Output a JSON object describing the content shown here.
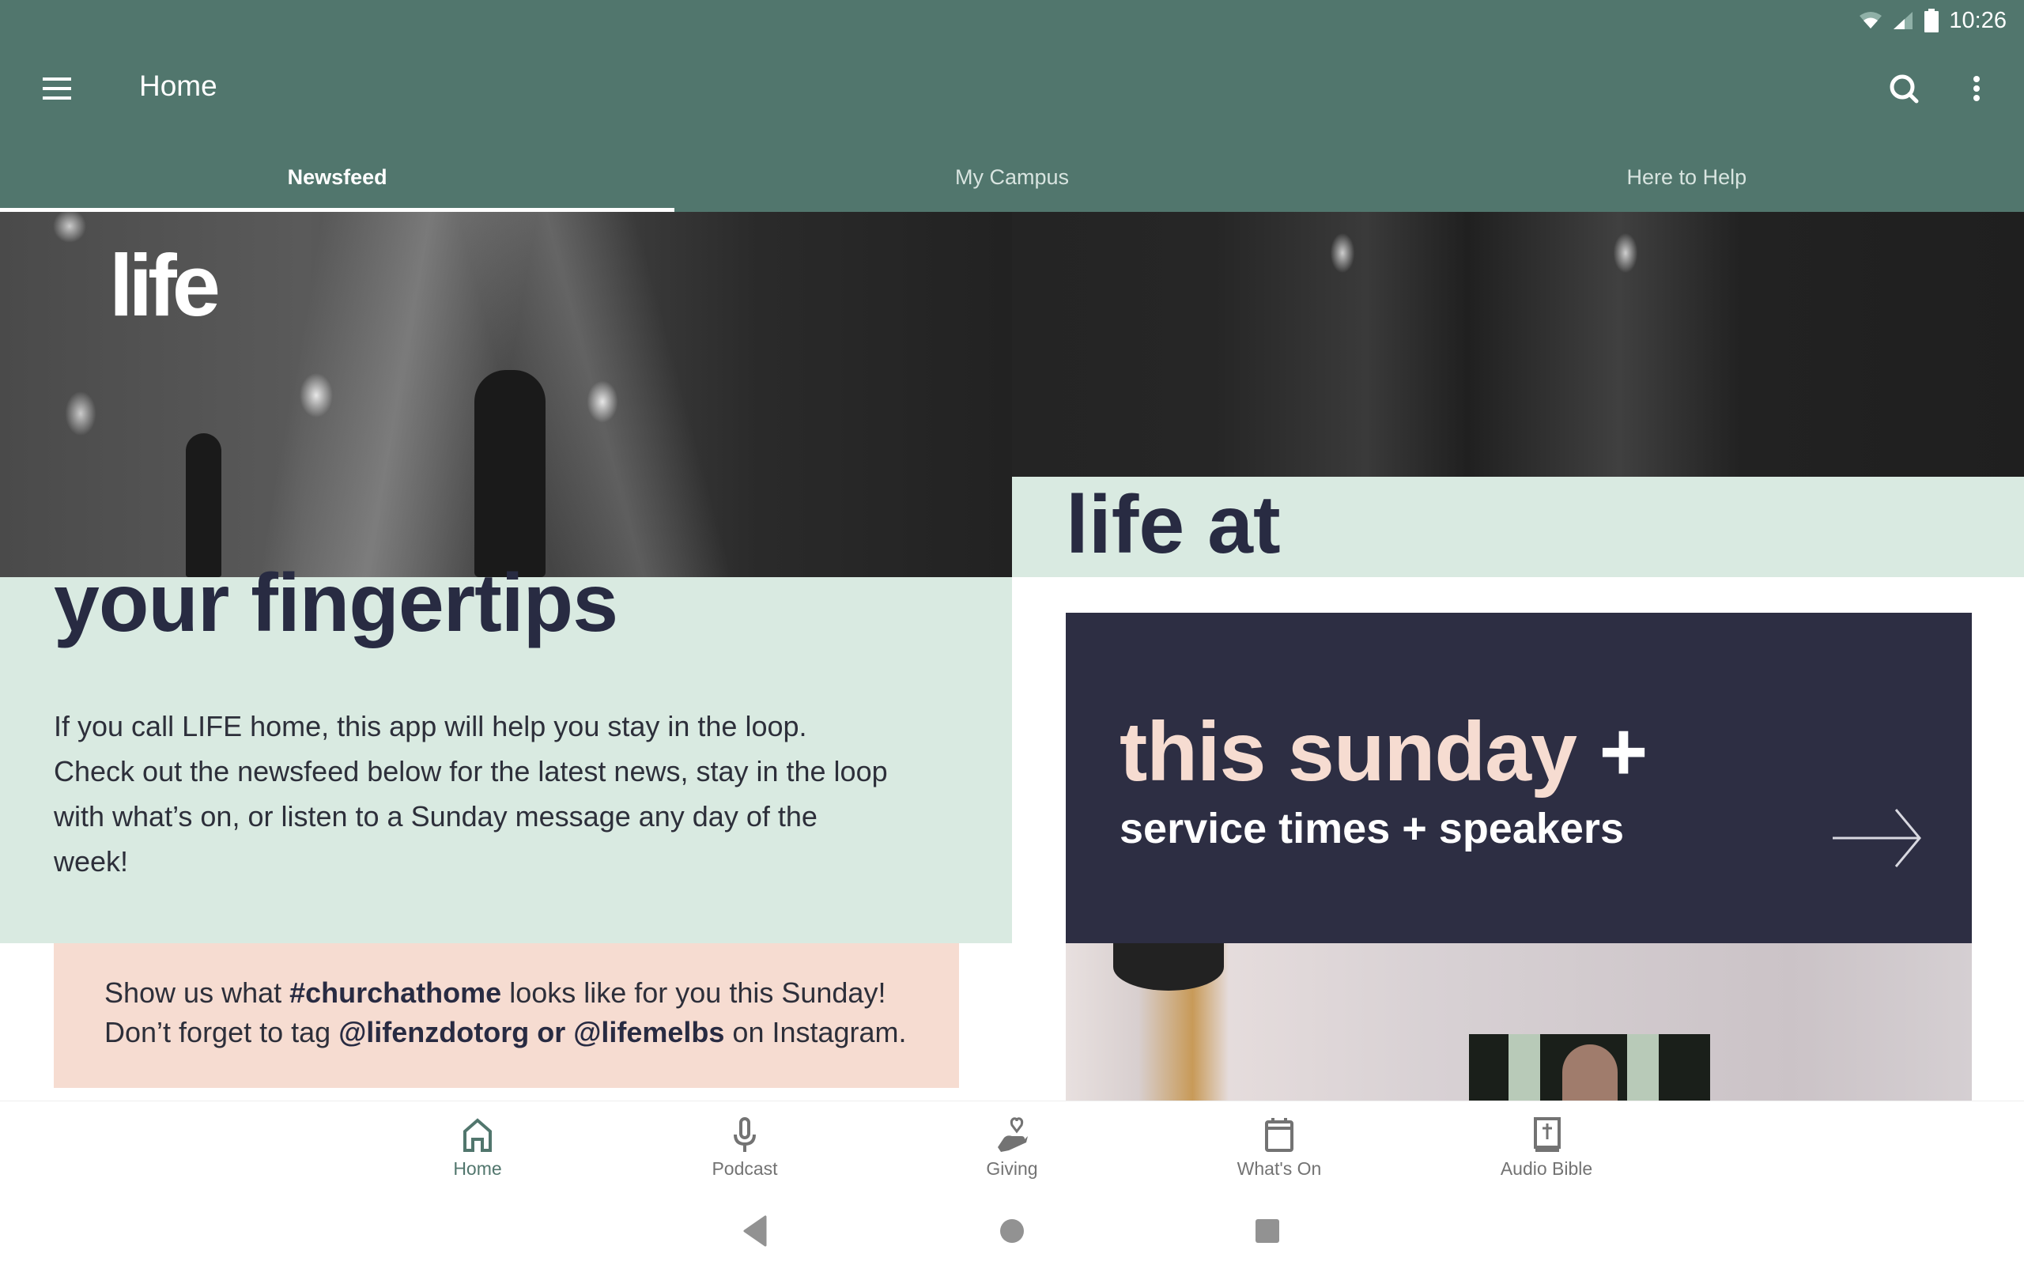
{
  "status_bar": {
    "time": "10:26",
    "icons": [
      "wifi-icon",
      "cellular-signal-icon",
      "battery-icon"
    ]
  },
  "app_bar": {
    "title": "Home",
    "menu_icon": "hamburger-menu-icon",
    "search_icon": "search-icon",
    "more_icon": "more-vertical-icon"
  },
  "tabs": [
    {
      "label": "Newsfeed",
      "active": true
    },
    {
      "label": "My Campus",
      "active": false
    },
    {
      "label": "Here to Help",
      "active": false
    }
  ],
  "colors": {
    "primary": "#51766d",
    "mint": "#d9eae1",
    "peach": "#f6dcd1",
    "navy": "#2d2e43",
    "headline": "#282b42",
    "inactive_icon": "#737373"
  },
  "feed": {
    "hero": {
      "logo": "life",
      "headline_top": "life at",
      "headline_bottom": "your fingertips",
      "body": "If you call LIFE home, this app will help you stay in the loop. Check out the newsfeed below for the latest news, stay in the loop with what’s on, or listen to a Sunday message any day of the week!"
    },
    "callout": {
      "line1_pre": "Show us what ",
      "line1_bold": "#churchathome",
      "line1_post": " looks like for you this Sunday!",
      "line2_pre": "Don’t forget to tag ",
      "line2_bold": "@lifenzdotorg or @lifemelbs",
      "line2_post": " on Instagram."
    },
    "sunday_card": {
      "title": "this sunday",
      "title_plus": "+",
      "subtitle": "service times + speakers",
      "arrow_icon": "arrow-right-icon"
    }
  },
  "bottom_nav": [
    {
      "label": "Home",
      "icon": "home-icon",
      "active": true
    },
    {
      "label": "Podcast",
      "icon": "microphone-icon",
      "active": false
    },
    {
      "label": "Giving",
      "icon": "giving-hand-heart-icon",
      "active": false
    },
    {
      "label": "What's On",
      "icon": "calendar-icon",
      "active": false
    },
    {
      "label": "Audio Bible",
      "icon": "bible-icon",
      "active": false
    }
  ],
  "system_nav": [
    "back-icon",
    "home-circle-icon",
    "recents-icon"
  ]
}
